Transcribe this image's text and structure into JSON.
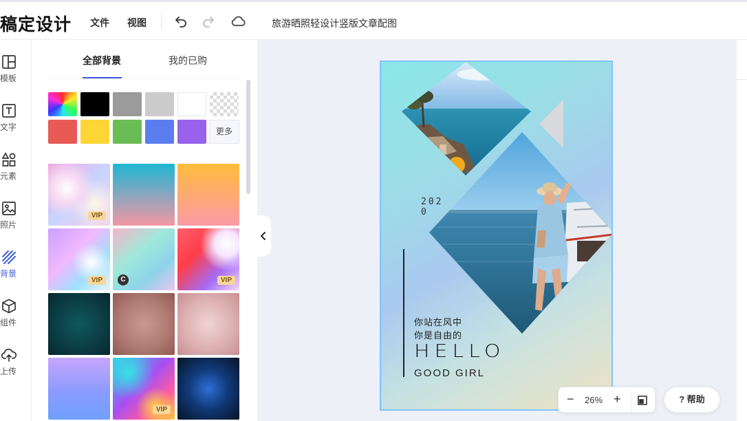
{
  "app": {
    "logo": "稿定设计"
  },
  "menu": {
    "file": "文件",
    "view": "视图"
  },
  "document": {
    "title": "旅游晒照轻设计竖版文章配图"
  },
  "rail": {
    "items": [
      {
        "label": "模板",
        "icon": "template-icon"
      },
      {
        "label": "文字",
        "icon": "text-icon"
      },
      {
        "label": "元素",
        "icon": "elements-icon"
      },
      {
        "label": "照片",
        "icon": "photo-icon"
      },
      {
        "label": "背景",
        "icon": "background-icon",
        "active": true
      },
      {
        "label": "组件",
        "icon": "component-icon"
      },
      {
        "label": "上传",
        "icon": "upload-icon"
      }
    ]
  },
  "panel": {
    "tabs": [
      {
        "label": "全部背景",
        "active": true
      },
      {
        "label": "我的已购"
      }
    ],
    "swatches": [
      "rainbow",
      "#000000",
      "#9b9b9b",
      "#cbcbcb",
      "#ffffff",
      "transparent",
      "#e85a56",
      "#fdd535",
      "#6abd55",
      "#5b7df0",
      "#9862ec"
    ],
    "more_label": "更多",
    "backgrounds": [
      {
        "name": "pastel-holo",
        "badge": "VIP"
      },
      {
        "name": "teal-pink-gradient",
        "badge": ""
      },
      {
        "name": "orange-pink-gradient",
        "badge": ""
      },
      {
        "name": "purple-holo",
        "badge": "VIP"
      },
      {
        "name": "mint-pink-holo",
        "badge": "C"
      },
      {
        "name": "red-purple-swirl",
        "badge": "VIP"
      },
      {
        "name": "dark-teal-vignette",
        "badge": ""
      },
      {
        "name": "rose-brown-vignette",
        "badge": ""
      },
      {
        "name": "pink-vignette",
        "badge": ""
      },
      {
        "name": "violet-blue-gradient",
        "badge": ""
      },
      {
        "name": "neon-wave",
        "badge": "VIP"
      },
      {
        "name": "blue-glow-dark",
        "badge": ""
      }
    ]
  },
  "poster": {
    "year": "202\n0",
    "line1": "你站在风中",
    "line2": "你是自由的",
    "headline": "HELLO",
    "subline": "GOOD GIRL"
  },
  "zoom": {
    "minus": "−",
    "value": "26%",
    "plus": "+"
  },
  "help": {
    "label": "? 帮助"
  }
}
